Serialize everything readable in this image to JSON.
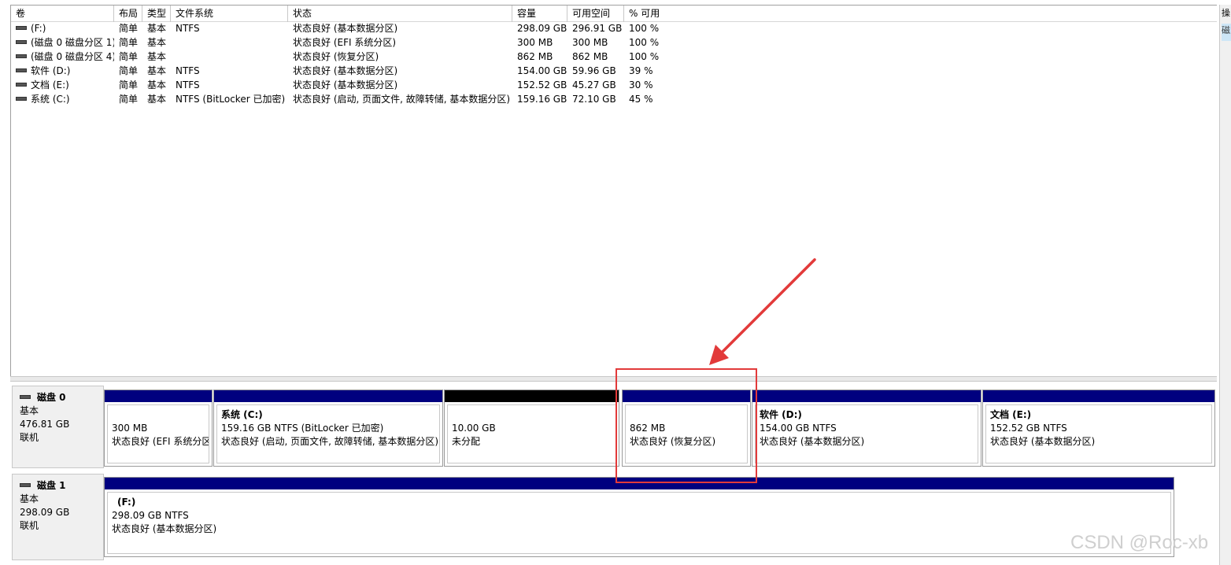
{
  "columns": [
    "卷",
    "布局",
    "类型",
    "文件系统",
    "状态",
    "容量",
    "可用空间",
    "% 可用"
  ],
  "volumes": [
    {
      "name": "(F:)",
      "layout": "简单",
      "type": "基本",
      "fs": "NTFS",
      "status": "状态良好 (基本数据分区)",
      "capacity": "298.09 GB",
      "free": "296.91 GB",
      "pct": "100 %"
    },
    {
      "name": "(磁盘 0 磁盘分区 1)",
      "layout": "简单",
      "type": "基本",
      "fs": "",
      "status": "状态良好 (EFI 系统分区)",
      "capacity": "300 MB",
      "free": "300 MB",
      "pct": "100 %"
    },
    {
      "name": "(磁盘 0 磁盘分区 4)",
      "layout": "简单",
      "type": "基本",
      "fs": "",
      "status": "状态良好 (恢复分区)",
      "capacity": "862 MB",
      "free": "862 MB",
      "pct": "100 %"
    },
    {
      "name": "软件 (D:)",
      "layout": "简单",
      "type": "基本",
      "fs": "NTFS",
      "status": "状态良好 (基本数据分区)",
      "capacity": "154.00 GB",
      "free": "59.96 GB",
      "pct": "39 %"
    },
    {
      "name": "文档 (E:)",
      "layout": "简单",
      "type": "基本",
      "fs": "NTFS",
      "status": "状态良好 (基本数据分区)",
      "capacity": "152.52 GB",
      "free": "45.27 GB",
      "pct": "30 %"
    },
    {
      "name": "系统 (C:)",
      "layout": "简单",
      "type": "基本",
      "fs": "NTFS (BitLocker 已加密)",
      "status": "状态良好 (启动, 页面文件, 故障转储, 基本数据分区)",
      "capacity": "159.16 GB",
      "free": "72.10 GB",
      "pct": "45 %"
    }
  ],
  "disks": [
    {
      "name": "磁盘 0",
      "type": "基本",
      "size": "476.81 GB",
      "state": "联机",
      "partitions": [
        {
          "title": "",
          "size": "300 MB",
          "status": "状态良好 (EFI 系统分区"
        },
        {
          "title": "系统  (C:)",
          "size": "159.16 GB NTFS (BitLocker 已加密)",
          "status": "状态良好 (启动, 页面文件, 故障转储, 基本数据分区)"
        },
        {
          "title": "",
          "size": "10.00 GB",
          "status": "未分配"
        },
        {
          "title": "",
          "size": "862 MB",
          "status": "状态良好 (恢复分区)"
        },
        {
          "title": "软件  (D:)",
          "size": "154.00 GB NTFS",
          "status": "状态良好 (基本数据分区)"
        },
        {
          "title": "文档  (E:)",
          "size": "152.52 GB NTFS",
          "status": "状态良好 (基本数据分区)"
        }
      ]
    },
    {
      "name": "磁盘 1",
      "type": "基本",
      "size": "298.09 GB",
      "state": "联机",
      "partitions": [
        {
          "title": "(F:)",
          "size": "298.09 GB NTFS",
          "status": "状态良好 (基本数据分区)"
        }
      ]
    }
  ],
  "right_strip": [
    "操",
    "磁"
  ],
  "watermark": "CSDN @Roc-xb",
  "colors": {
    "partition_bar": "#00007f",
    "unallocated_bar": "#000000",
    "annotation": "#e23a3a"
  }
}
